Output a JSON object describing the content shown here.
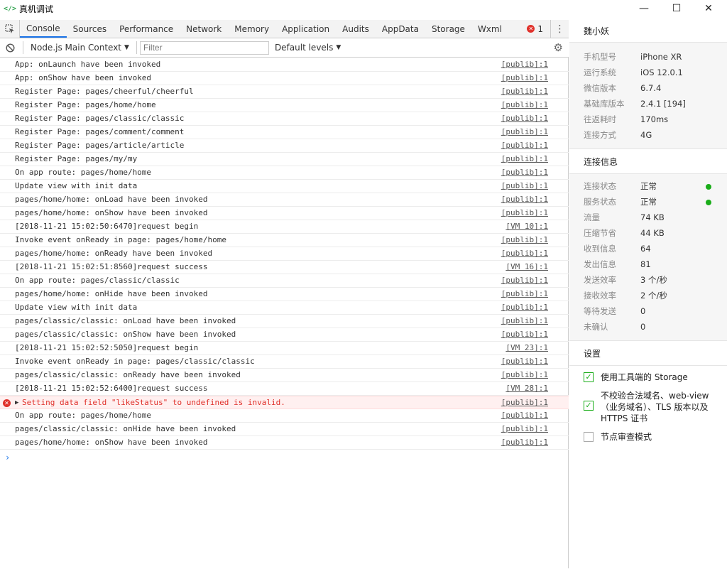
{
  "window": {
    "icon": "</>",
    "title": "真机调试",
    "controls": {
      "minimize": "—",
      "maximize": "☐",
      "close": "✕"
    }
  },
  "tabs": [
    "Console",
    "Sources",
    "Performance",
    "Network",
    "Memory",
    "Application",
    "Audits",
    "AppData",
    "Storage",
    "Wxml"
  ],
  "error_count": "1",
  "toolbar": {
    "context": "Node.js Main Context",
    "filter_placeholder": "Filter",
    "levels": "Default levels"
  },
  "console": [
    {
      "msg": "App: onLaunch have been invoked",
      "src": "[publib]:1"
    },
    {
      "msg": "App: onShow have been invoked",
      "src": "[publib]:1"
    },
    {
      "msg": "Register Page: pages/cheerful/cheerful",
      "src": "[publib]:1"
    },
    {
      "msg": "Register Page: pages/home/home",
      "src": "[publib]:1"
    },
    {
      "msg": "Register Page: pages/classic/classic",
      "src": "[publib]:1"
    },
    {
      "msg": "Register Page: pages/comment/comment",
      "src": "[publib]:1"
    },
    {
      "msg": "Register Page: pages/article/article",
      "src": "[publib]:1"
    },
    {
      "msg": "Register Page: pages/my/my",
      "src": "[publib]:1"
    },
    {
      "msg": "On app route: pages/home/home",
      "src": "[publib]:1"
    },
    {
      "msg": "Update view with init data",
      "src": "[publib]:1"
    },
    {
      "msg": "pages/home/home: onLoad have been invoked",
      "src": "[publib]:1"
    },
    {
      "msg": "pages/home/home: onShow have been invoked",
      "src": "[publib]:1"
    },
    {
      "msg": "[2018-11-21 15:02:50:6470]request begin",
      "src": "[VM 10]:1"
    },
    {
      "msg": "Invoke event onReady in page: pages/home/home",
      "src": "[publib]:1"
    },
    {
      "msg": "pages/home/home: onReady have been invoked",
      "src": "[publib]:1"
    },
    {
      "msg": "[2018-11-21 15:02:51:8560]request success",
      "src": "[VM 16]:1"
    },
    {
      "msg": "On app route: pages/classic/classic",
      "src": "[publib]:1"
    },
    {
      "msg": "pages/home/home: onHide have been invoked",
      "src": "[publib]:1"
    },
    {
      "msg": "Update view with init data",
      "src": "[publib]:1"
    },
    {
      "msg": "pages/classic/classic: onLoad have been invoked",
      "src": "[publib]:1"
    },
    {
      "msg": "pages/classic/classic: onShow have been invoked",
      "src": "[publib]:1"
    },
    {
      "msg": "[2018-11-21 15:02:52:5050]request begin",
      "src": "[VM 23]:1"
    },
    {
      "msg": "Invoke event onReady in page: pages/classic/classic",
      "src": "[publib]:1"
    },
    {
      "msg": "pages/classic/classic: onReady have been invoked",
      "src": "[publib]:1"
    },
    {
      "msg": "[2018-11-21 15:02:52:6400]request success",
      "src": "[VM 28]:1"
    },
    {
      "msg": "Setting data field \"likeStatus\" to undefined is invalid.",
      "src": "[publib]:1",
      "error": true
    },
    {
      "msg": "On app route: pages/home/home",
      "src": "[publib]:1"
    },
    {
      "msg": "pages/classic/classic: onHide have been invoked",
      "src": "[publib]:1"
    },
    {
      "msg": "pages/home/home: onShow have been invoked",
      "src": "[publib]:1"
    }
  ],
  "prompt": "›",
  "panel": {
    "user": "魏小妖",
    "device": [
      {
        "k": "手机型号",
        "v": "iPhone XR"
      },
      {
        "k": "运行系统",
        "v": "iOS 12.0.1"
      },
      {
        "k": "微信版本",
        "v": "6.7.4"
      },
      {
        "k": "基础库版本",
        "v": "2.4.1 [194]"
      },
      {
        "k": "往返耗时",
        "v": "170ms"
      },
      {
        "k": "连接方式",
        "v": "4G"
      }
    ],
    "conn_title": "连接信息",
    "conn": [
      {
        "k": "连接状态",
        "v": "正常",
        "dot": true
      },
      {
        "k": "服务状态",
        "v": "正常",
        "dot": true
      },
      {
        "k": "流量",
        "v": "74 KB"
      },
      {
        "k": "压缩节省",
        "v": "44 KB"
      },
      {
        "k": "收到信息",
        "v": "64"
      },
      {
        "k": "发出信息",
        "v": "81"
      },
      {
        "k": "发送效率",
        "v": "3 个/秒"
      },
      {
        "k": "接收效率",
        "v": "2 个/秒"
      },
      {
        "k": "等待发送",
        "v": "0"
      },
      {
        "k": "未确认",
        "v": "0"
      }
    ],
    "settings_title": "设置",
    "settings": [
      {
        "label": "使用工具端的 Storage",
        "checked": true
      },
      {
        "label": "不校验合法域名、web-view（业务域名）、TLS 版本以及 HTTPS 证书",
        "checked": true
      },
      {
        "label": "节点审查模式",
        "checked": false
      }
    ],
    "status_color": "#1aad19"
  },
  "colors": {
    "accent": "#1a73e8",
    "error": "#e0302a",
    "ok": "#1aad19"
  }
}
